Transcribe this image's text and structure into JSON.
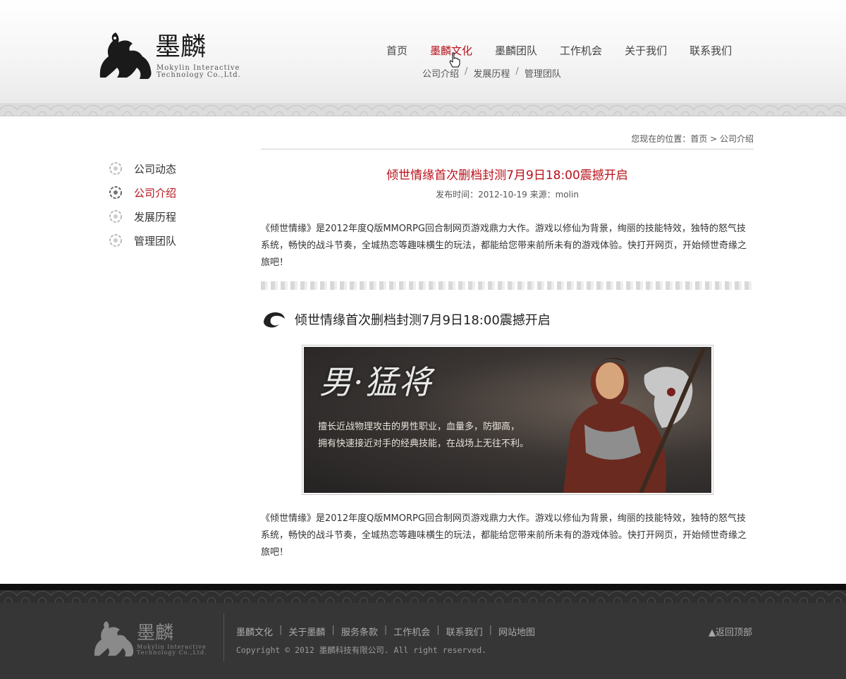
{
  "header": {
    "logo_en_line1": "Mokylin Interactive",
    "logo_en_line2": "Technology Co.,Ltd.",
    "nav": [
      {
        "label": "首页"
      },
      {
        "label": "墨麟文化"
      },
      {
        "label": "墨麟团队"
      },
      {
        "label": "工作机会"
      },
      {
        "label": "关于我们"
      },
      {
        "label": "联系我们"
      }
    ],
    "subnav": [
      "公司介绍",
      "发展历程",
      "管理团队"
    ],
    "subnav_sep": "/"
  },
  "sidebar": {
    "items": [
      {
        "label": "公司动态"
      },
      {
        "label": "公司介绍"
      },
      {
        "label": "发展历程"
      },
      {
        "label": "管理团队"
      }
    ]
  },
  "main": {
    "breadcrumb": "您现在的位置：首页 > 公司介绍",
    "title": "倾世情缘首次删档封测7月9日18:00震撼开启",
    "meta": "发布时间：2012-10-19 来源：molin",
    "para1": "《倾世情缘》是2012年度Q版MMORPG回合制网页游戏鼎力大作。游戏以修仙为背景，绚丽的技能特效，独特的怒气技系统，畅快的战斗节奏，全城热恋等趣味横生的玩法，都能给您带来前所未有的游戏体验。快打开网页，开始倾世奇缘之旅吧！",
    "sub_heading": "倾世情缘首次删档封测7月9日18:00震撼开启",
    "banner": {
      "title": "男·猛将",
      "line1": "擅长近战物理攻击的男性职业，血量多，防御高，",
      "line2": "拥有快速接近对手的经典技能，在战场上无往不利。"
    },
    "para2": "《倾世情缘》是2012年度Q版MMORPG回合制网页游戏鼎力大作。游戏以修仙为背景，绚丽的技能特效，独特的怒气技系统，畅快的战斗节奏，全城热恋等趣味横生的玩法，都能给您带来前所未有的游戏体验。快打开网页，开始倾世奇缘之旅吧！"
  },
  "footer": {
    "logo_en_line1": "Mokylin Interactive",
    "logo_en_line2": "Technology Co.,Ltd.",
    "links": [
      "墨麟文化",
      "关于墨麟",
      "服务条款",
      "工作机会",
      "联系我们",
      "网站地图"
    ],
    "link_sep": "|",
    "copyright": "Copyright © 2012 墨麟科技有限公司. All right reserved.",
    "back_to_top": "▲返回顶部"
  },
  "colors": {
    "accent": "#b8101a",
    "footer_bg": "#363636"
  }
}
